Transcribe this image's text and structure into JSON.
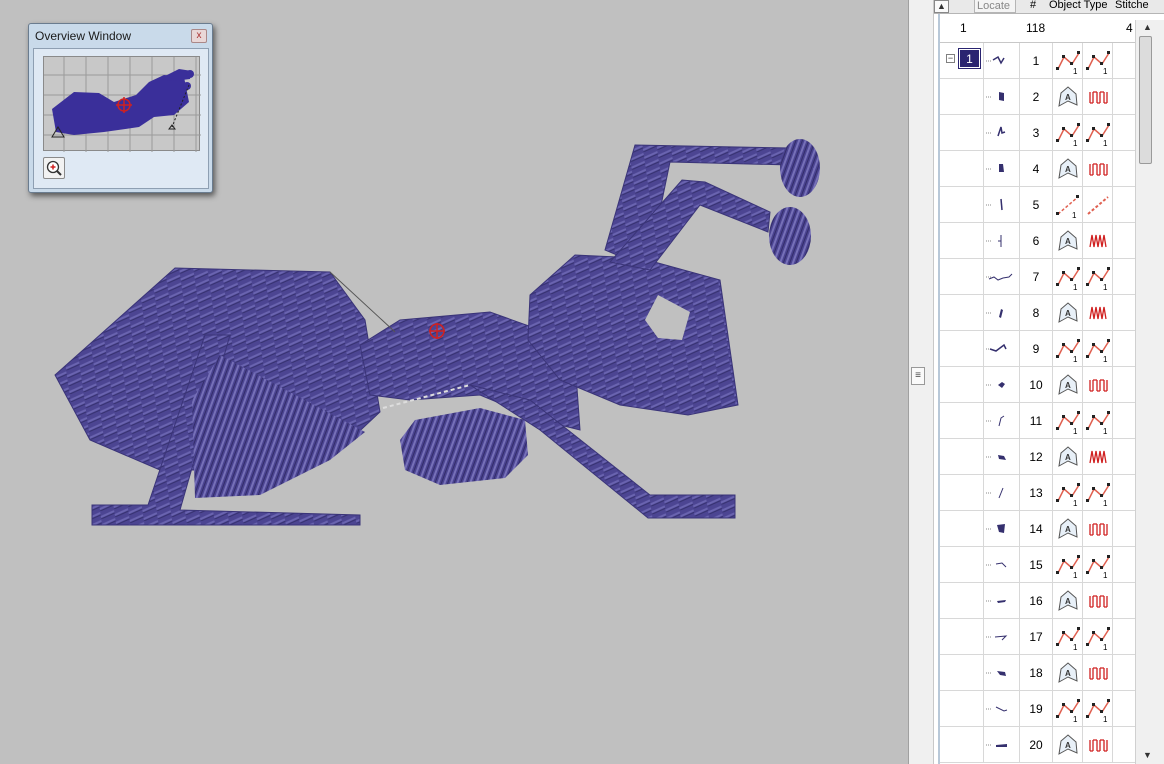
{
  "overview_window": {
    "title": "Overview Window",
    "close_label": "x"
  },
  "object_list": {
    "header": {
      "locate_label": "Locate",
      "number_label": "#",
      "object_type_label": "Object Type",
      "stitches_label": "Stitche"
    },
    "summary": {
      "group_count": "1",
      "object_count": "118",
      "stitch_partial": "4"
    },
    "group_label": "1",
    "rows": [
      {
        "num": "1",
        "type": "run"
      },
      {
        "num": "2",
        "type": "fill"
      },
      {
        "num": "3",
        "type": "run"
      },
      {
        "num": "4",
        "type": "fill"
      },
      {
        "num": "5",
        "type": "line"
      },
      {
        "num": "6",
        "type": "satin"
      },
      {
        "num": "7",
        "type": "run"
      },
      {
        "num": "8",
        "type": "satin"
      },
      {
        "num": "9",
        "type": "run"
      },
      {
        "num": "10",
        "type": "fill"
      },
      {
        "num": "11",
        "type": "run"
      },
      {
        "num": "12",
        "type": "satin"
      },
      {
        "num": "13",
        "type": "run"
      },
      {
        "num": "14",
        "type": "fill"
      },
      {
        "num": "15",
        "type": "run"
      },
      {
        "num": "16",
        "type": "fill"
      },
      {
        "num": "17",
        "type": "run"
      },
      {
        "num": "18",
        "type": "fill"
      },
      {
        "num": "19",
        "type": "run"
      },
      {
        "num": "20",
        "type": "fill"
      }
    ]
  },
  "colors": {
    "thread": "#4c4592",
    "thread_dark": "#35306e",
    "canvas_bg": "#c0c0c0",
    "marker_red": "#d02020"
  }
}
